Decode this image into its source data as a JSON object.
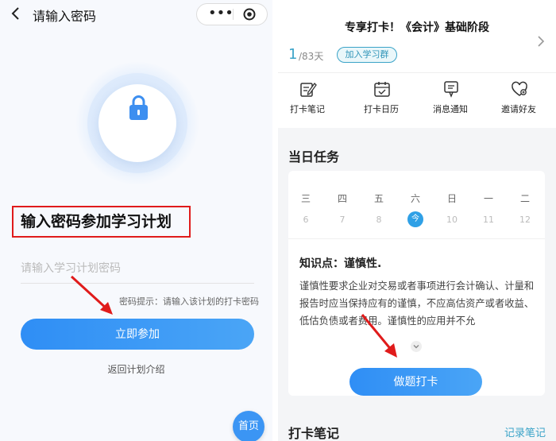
{
  "left": {
    "nav_title": "请输入密码",
    "heading": "输入密码参加学习计划",
    "input_placeholder": "请输入学习计划密码",
    "input_value": "",
    "hint": "密码提示：请输入该计划的打卡密码",
    "join_button": "立即参加",
    "back_link": "返回计划介绍",
    "home_button": "首页"
  },
  "right": {
    "plan_title": "专享打卡！《会计》基础阶段",
    "day_current": "1",
    "day_total": "/83天",
    "join_group": "加入学习群",
    "quick_actions": [
      {
        "label": "打卡笔记",
        "icon": "note-edit-icon"
      },
      {
        "label": "打卡日历",
        "icon": "calendar-check-icon"
      },
      {
        "label": "消息通知",
        "icon": "message-icon"
      },
      {
        "label": "邀请好友",
        "icon": "heart-invite-icon"
      }
    ],
    "section_today": "当日任务",
    "weekdays": [
      "三",
      "四",
      "五",
      "六",
      "日",
      "一",
      "二"
    ],
    "dates": [
      "6",
      "7",
      "8",
      "今",
      "10",
      "11",
      "12"
    ],
    "today_index": 3,
    "knowledge_title": "知识点：谨慎性.",
    "knowledge_body": "谨慎性要求企业对交易或者事项进行会计确认、计量和报告时应当保持应有的谨慎，不应高估资产或者收益、低估负债或者费用。谨慎性的应用并不允",
    "checkin_button": "做题打卡",
    "section_notes": "打卡笔记",
    "record_link": "记录笔记"
  },
  "colors": {
    "primary": "#2f8ef5",
    "accent_teal": "#3aa3c8",
    "highlight_red": "#e01b1b"
  }
}
